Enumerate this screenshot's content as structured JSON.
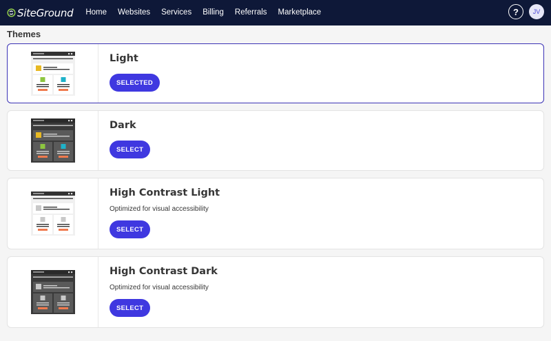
{
  "brand": {
    "name": "SiteGround"
  },
  "nav": [
    "Home",
    "Websites",
    "Services",
    "Billing",
    "Referrals",
    "Marketplace"
  ],
  "header": {
    "help_symbol": "?",
    "avatar_initials": "JV"
  },
  "page": {
    "title": "Themes"
  },
  "themes": [
    {
      "name": "Light",
      "description": "",
      "button": "SELECTED",
      "selected": true,
      "variant": "light",
      "colors": {
        "frame": "#f0f0f0",
        "panel": "#ffffff",
        "bar": "#333333",
        "line": "#333333",
        "accent1": "#e8b923",
        "accent2": "#8dc63f",
        "accent3": "#1eb2c9",
        "footer": "#f07a4e"
      }
    },
    {
      "name": "Dark",
      "description": "",
      "button": "SELECT",
      "selected": false,
      "variant": "dark",
      "colors": {
        "frame": "#3a3a3a",
        "panel": "#5a5a5a",
        "bar": "#2a2a2a",
        "line": "#d0d0d0",
        "accent1": "#e8b923",
        "accent2": "#8dc63f",
        "accent3": "#1eb2c9",
        "footer": "#f07a4e"
      }
    },
    {
      "name": "High Contrast Light",
      "description": "Optimized for visual accessibility",
      "button": "SELECT",
      "selected": false,
      "variant": "hc-light",
      "colors": {
        "frame": "#f0f0f0",
        "panel": "#ffffff",
        "bar": "#333333",
        "line": "#333333",
        "accent1": "#c8c8c8",
        "accent2": "#c8c8c8",
        "accent3": "#c8c8c8",
        "footer": "#f07a4e"
      }
    },
    {
      "name": "High Contrast Dark",
      "description": "Optimized for visual accessibility",
      "button": "SELECT",
      "selected": false,
      "variant": "hc-dark",
      "colors": {
        "frame": "#3a3a3a",
        "panel": "#5a5a5a",
        "bar": "#2a2a2a",
        "line": "#d0d0d0",
        "accent1": "#c8c8c8",
        "accent2": "#c8c8c8",
        "accent3": "#c8c8c8",
        "footer": "#f07a4e"
      }
    }
  ],
  "colors": {
    "topbar": "#0e1838",
    "primary": "#3f38e0",
    "selected_border": "#3a31b5",
    "background": "#f5f5f5"
  }
}
